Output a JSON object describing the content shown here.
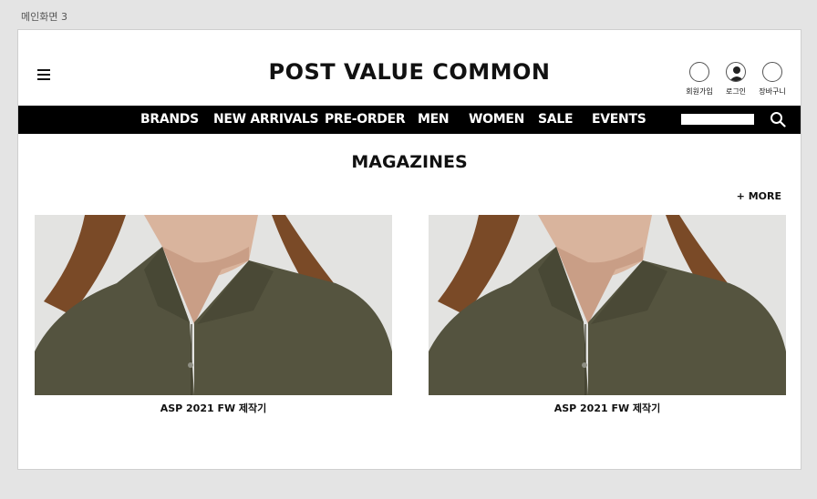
{
  "screen_label": "메인화면 3",
  "header": {
    "brand": "POST VALUE COMMON",
    "utility": {
      "signup": "회원가입",
      "login": "로그인",
      "cart": "장바구니"
    }
  },
  "nav": {
    "items": [
      "BRANDS",
      "NEW ARRIVALS",
      "PRE-ORDER",
      "MEN",
      "WOMEN",
      "SALE",
      "EVENTS"
    ],
    "search_placeholder": ""
  },
  "magazines": {
    "title": "MAGAZINES",
    "more_label": "+ MORE",
    "cards": [
      {
        "caption": "ASP 2021 FW 제작기",
        "image": "model-wearing-olive-shirt"
      },
      {
        "caption": "ASP 2021 FW 제작기",
        "image": "model-wearing-olive-shirt"
      }
    ]
  },
  "colors": {
    "nav_bg": "#000000",
    "shirt": "#54533f",
    "photo_bg": "#e3e3e1",
    "hair": "#7a4a27"
  }
}
